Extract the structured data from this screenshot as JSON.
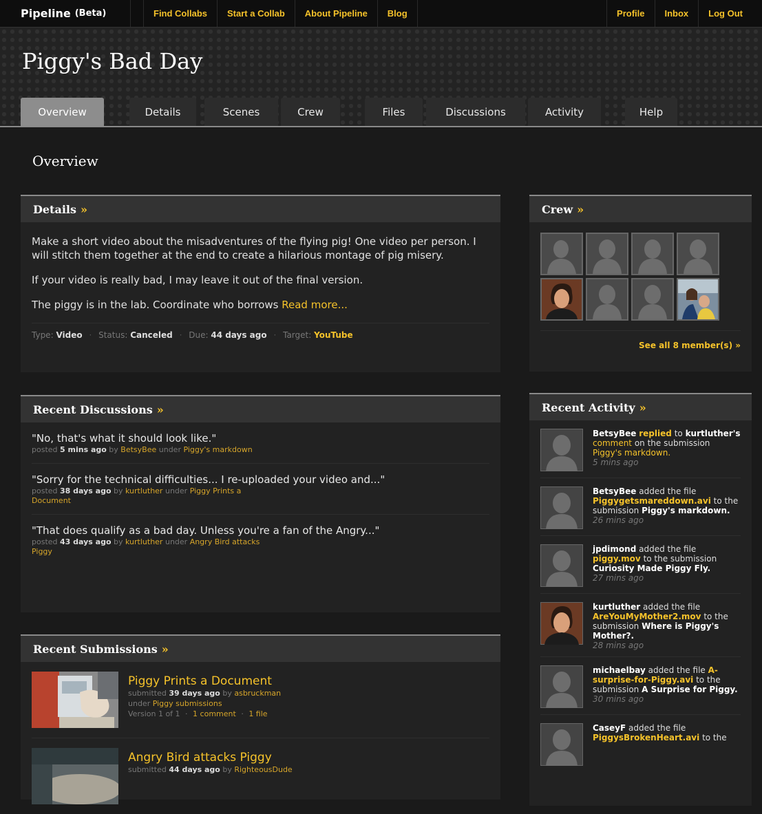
{
  "topbar": {
    "brand": "Pipeline",
    "beta": "(Beta)",
    "left_links": [
      "Find Collabs",
      "Start a Collab",
      "About Pipeline",
      "Blog"
    ],
    "right_links": [
      "Profile",
      "Inbox",
      "Log Out"
    ]
  },
  "header": {
    "title": "Piggy's Bad Day",
    "tabs": [
      "Overview",
      "Details",
      "Scenes",
      "Crew",
      "Files",
      "Discussions",
      "Activity",
      "Help"
    ],
    "active_tab": "Overview"
  },
  "page_title": "Overview",
  "details": {
    "heading": "Details",
    "arrow": "»",
    "para1": "Make a short video about the misadventures of the flying pig! One video per person. I will stitch them together at the end to create a hilarious montage of pig misery.",
    "para2": "If your video is really bad, I may leave it out of the final version.",
    "para3": "The piggy is in the lab. Coordinate who borrows",
    "read_more": "Read more...",
    "type_label": "Type:",
    "type_value": "Video",
    "status_label": "Status:",
    "status_value": "Canceled",
    "due_label": "Due:",
    "due_value": "44 days ago",
    "target_label": "Target:",
    "target_value": "YouTube",
    "sep": "·"
  },
  "discussions": {
    "heading": "Recent Discussions",
    "arrow": "»",
    "items": [
      {
        "quote": "\"No, that's what it should look like.\"",
        "posted": "posted",
        "time": "5 mins ago",
        "by": "by",
        "user": "BetsyBee",
        "under": "under",
        "topic": "Piggy's markdown"
      },
      {
        "quote": "\"Sorry for the technical difficulties... I re-uploaded your video and...\"",
        "posted": "posted",
        "time": "38 days ago",
        "by": "by",
        "user": "kurtluther",
        "under": "under",
        "topic": "Piggy Prints a Document"
      },
      {
        "quote": "\"That does qualify as a bad day. Unless you're a fan of the Angry...\"",
        "posted": "posted",
        "time": "43 days ago",
        "by": "by",
        "user": "kurtluther",
        "under": "under",
        "topic": "Angry Bird attacks Piggy"
      }
    ]
  },
  "submissions": {
    "heading": "Recent Submissions",
    "arrow": "»",
    "items": [
      {
        "title": "Piggy Prints a Document",
        "submitted": "submitted",
        "time": "39 days ago",
        "by": "by",
        "user": "asbruckman",
        "under": "under",
        "group": "Piggy submissions",
        "version": "Version 1 of 1",
        "comments": "1 comment",
        "files": "1 file",
        "sep": "·"
      },
      {
        "title": "Angry Bird attacks Piggy",
        "submitted": "submitted",
        "time": "44 days ago",
        "by": "by",
        "user": "RighteousDude"
      }
    ]
  },
  "crew": {
    "heading": "Crew",
    "arrow": "»",
    "see_all": "See all 8 member(s) »",
    "members": [
      "silhouette",
      "silhouette",
      "silhouette",
      "silhouette",
      "photo-man",
      "silhouette",
      "silhouette",
      "photo-family"
    ]
  },
  "activity": {
    "heading": "Recent Activity",
    "arrow": "»",
    "items": [
      {
        "avatar": "silhouette",
        "user": "BetsyBee",
        "p1": "replied",
        "p2": "to",
        "p3": "kurtluther's",
        "p4": "comment",
        "p5": "on the submission",
        "p6": "Piggy's markdown.",
        "time": "5 mins ago"
      },
      {
        "avatar": "silhouette",
        "user": "BetsyBee",
        "p1": "added the file",
        "p2": "Piggygetsmareddown.avi",
        "p3": "to the submission",
        "p4": "Piggy's markdown.",
        "time": "26 mins ago"
      },
      {
        "avatar": "silhouette",
        "user": "jpdimond",
        "p1": "added the file",
        "p2": "piggy.mov",
        "p3": "to the submission",
        "p4": "Curiosity Made Piggy Fly.",
        "time": "27 mins ago"
      },
      {
        "avatar": "photo-man",
        "user": "kurtluther",
        "p1": "added the file",
        "p2": "AreYouMyMother2.mov",
        "p3": "to the submission",
        "p4": "Where is Piggy's Mother?.",
        "time": "28 mins ago"
      },
      {
        "avatar": "silhouette",
        "user": "michaelbay",
        "p1": "added the file",
        "p2": "A-surprise-for-Piggy.avi",
        "p3": "to the submission",
        "p4": "A Surprise for Piggy.",
        "time": "30 mins ago"
      },
      {
        "avatar": "silhouette",
        "user": "CaseyF",
        "p1": "added the file",
        "p2": "PiggysBrokenHeart.avi",
        "p3": "to the",
        "p4": "",
        "time": ""
      }
    ]
  },
  "colors": {
    "accent": "#f5c22a",
    "background": "#1a1a1a",
    "panel": "#222222",
    "panel_header": "#333333",
    "active_tab": "#8d8d8d"
  }
}
